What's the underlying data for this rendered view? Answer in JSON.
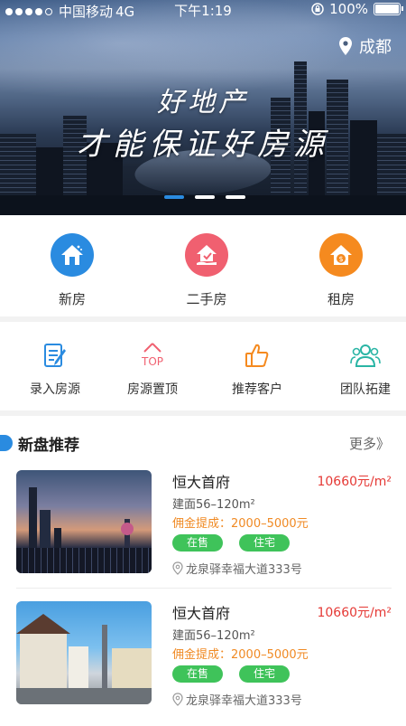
{
  "status_bar": {
    "carrier": "中国移动",
    "network": "4G",
    "time": "下午1:19",
    "battery": "100%"
  },
  "banner": {
    "location": "成都",
    "slogan_line1": "好地产",
    "slogan_line2": "才能保证好房源"
  },
  "categories": [
    {
      "label": "新房",
      "icon": "house-icon",
      "color": "#2a8be0"
    },
    {
      "label": "二手房",
      "icon": "hand-house-icon",
      "color": "#f06070"
    },
    {
      "label": "租房",
      "icon": "rent-house-icon",
      "color": "#f58a1f"
    }
  ],
  "tools": [
    {
      "label": "录入房源",
      "icon": "edit-document-icon",
      "color": "#2a8be0"
    },
    {
      "label": "房源置顶",
      "icon": "top-icon",
      "color": "#f06070"
    },
    {
      "label": "推荐客户",
      "icon": "thumbs-up-icon",
      "color": "#f58a1f"
    },
    {
      "label": "团队拓建",
      "icon": "team-icon",
      "color": "#2ab5a5"
    }
  ],
  "section": {
    "title": "新盘推荐",
    "more": "更多》"
  },
  "listings": [
    {
      "name": "恒大首府",
      "price": "10660元/m²",
      "area": "建面56–120m²",
      "commission": "佣金提成：2000–5000元",
      "tags": [
        "在售",
        "住宅"
      ],
      "address": "龙泉驿幸福大道333号"
    },
    {
      "name": "恒大首府",
      "price": "10660元/m²",
      "area": "建面56–120m²",
      "commission": "佣金提成：2000–5000元",
      "tags": [
        "在售",
        "住宅"
      ],
      "address": "龙泉驿幸福大道333号"
    }
  ]
}
